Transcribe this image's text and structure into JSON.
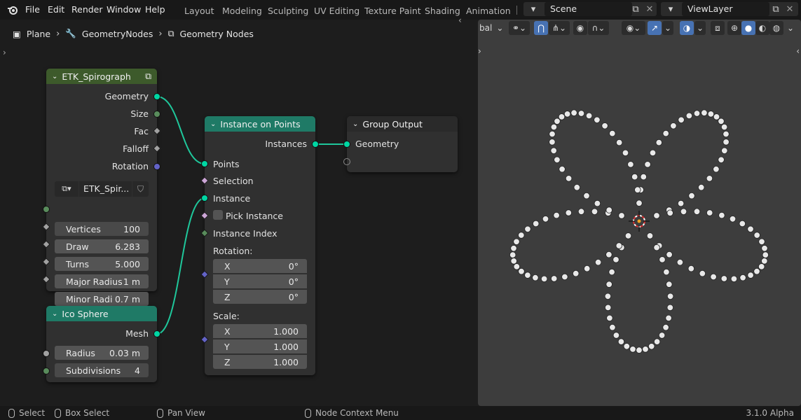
{
  "menu": {
    "file": "File",
    "edit": "Edit",
    "render": "Render",
    "window": "Window",
    "help": "Help"
  },
  "workspaces": [
    "Layout",
    "Modeling",
    "Sculpting",
    "UV Editing",
    "Texture Paint",
    "Shading",
    "Animation"
  ],
  "scene": {
    "name": "Scene",
    "view_layer": "ViewLayer"
  },
  "breadcrumb": {
    "object": "Plane",
    "modifier": "GeometryNodes",
    "tree": "Geometry Nodes"
  },
  "nodes": {
    "spiro": {
      "title": "ETK_Spirograph",
      "outputs": [
        "Geometry",
        "Size",
        "Fac",
        "Falloff",
        "Rotation"
      ],
      "group_name": "ETK_Spir...",
      "inputs": [
        {
          "label": "Vertices",
          "value": "100"
        },
        {
          "label": "Draw",
          "value": "6.283"
        },
        {
          "label": "Turns",
          "value": "5.000"
        },
        {
          "label": "Major Radius",
          "value": "1 m"
        },
        {
          "label": "Minor Radi",
          "value": "0.7 m"
        }
      ]
    },
    "ico": {
      "title": "Ico Sphere",
      "output": "Mesh",
      "inputs": [
        {
          "label": "Radius",
          "value": "0.03 m"
        },
        {
          "label": "Subdivisions",
          "value": "4"
        }
      ]
    },
    "instance": {
      "title": "Instance on Points",
      "output": "Instances",
      "points": "Points",
      "selection": "Selection",
      "instance": "Instance",
      "pick_instance": "Pick Instance",
      "instance_index": "Instance Index",
      "rotation_label": "Rotation:",
      "rotation": [
        {
          "axis": "X",
          "value": "0°"
        },
        {
          "axis": "Y",
          "value": "0°"
        },
        {
          "axis": "Z",
          "value": "0°"
        }
      ],
      "scale_label": "Scale:",
      "scale": [
        {
          "axis": "X",
          "value": "1.000"
        },
        {
          "axis": "Y",
          "value": "1.000"
        },
        {
          "axis": "Z",
          "value": "1.000"
        }
      ]
    },
    "output": {
      "title": "Group Output",
      "input": "Geometry"
    }
  },
  "viewport": {
    "orientation": "bal"
  },
  "status": {
    "select": "Select",
    "box_select": "Box Select",
    "pan_view": "Pan View",
    "context_menu": "Node Context Menu",
    "version": "3.1.0 Alpha"
  },
  "colors": {
    "accent": "#4772b3",
    "geometry_socket": "#00d6a3",
    "group_header": "#3d5a2b",
    "geometry_header": "#1f7a66"
  }
}
